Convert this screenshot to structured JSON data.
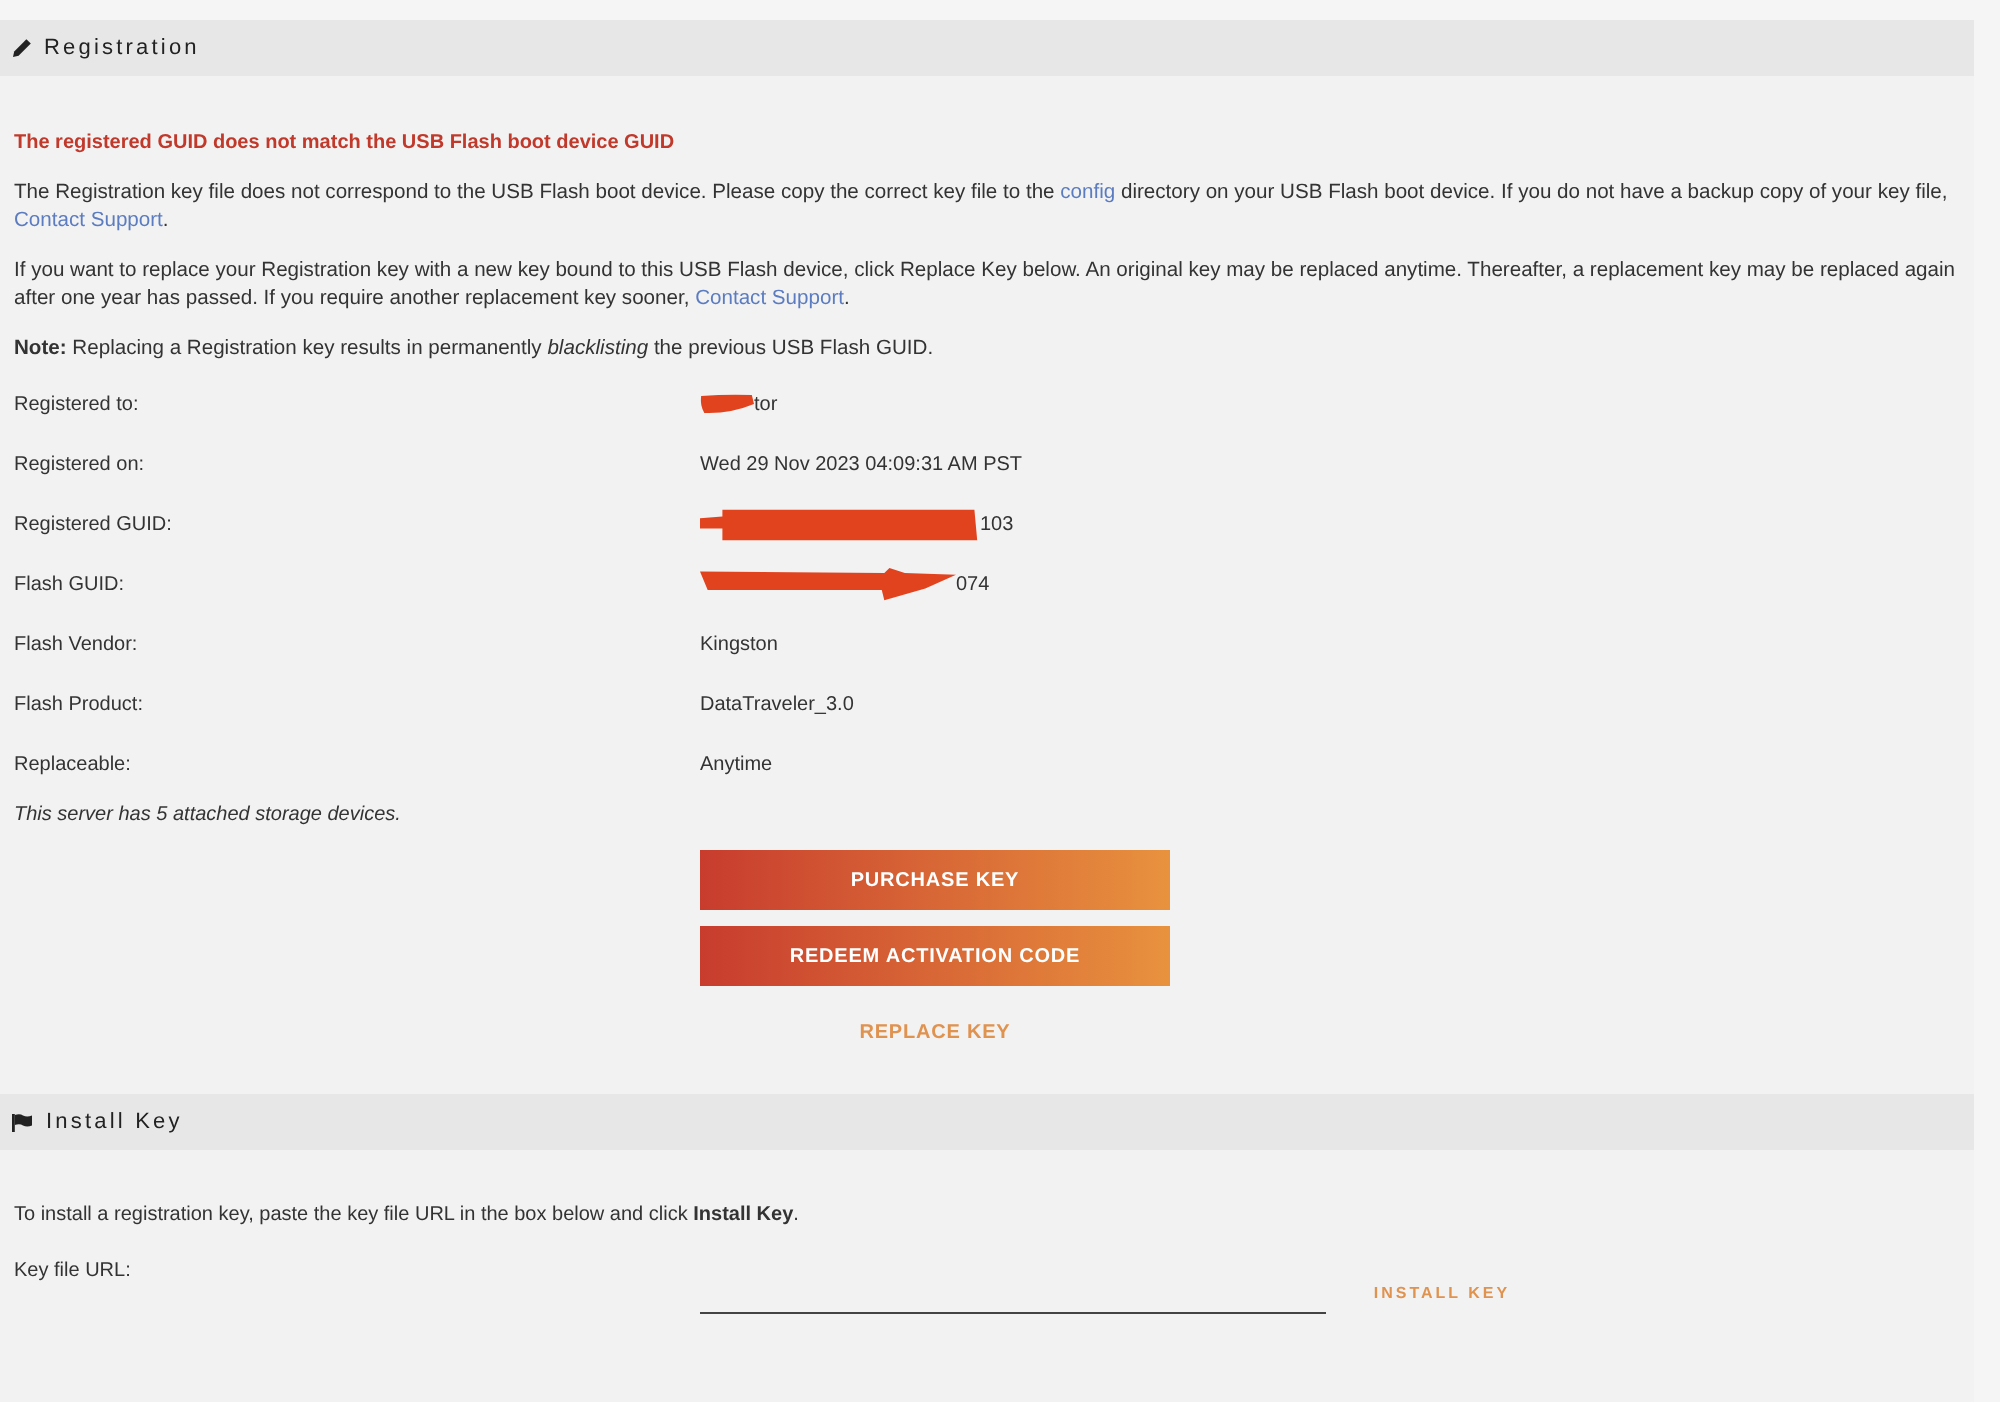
{
  "registration": {
    "title": "Registration",
    "error": "The registered GUID does not match the USB Flash boot device GUID",
    "paragraphs": [
      [
        {
          "kind": "text",
          "text": "The Registration key file does not correspond to the USB Flash boot device. Please copy the correct key file to the "
        },
        {
          "kind": "link",
          "text": "config"
        },
        {
          "kind": "text",
          "text": " directory on your USB Flash boot device. If you do not have a backup copy of your key file, "
        },
        {
          "kind": "link",
          "text": "Contact Support"
        },
        {
          "kind": "text",
          "text": "."
        }
      ],
      [
        {
          "kind": "text",
          "text": "If you want to replace your Registration key with a new key bound to this USB Flash device, click Replace Key below. An original key may be replaced anytime. Thereafter, a replacement key may be replaced again after one year has passed. If you require another replacement key sooner, "
        },
        {
          "kind": "link",
          "text": "Contact Support"
        },
        {
          "kind": "text",
          "text": "."
        }
      ]
    ],
    "note": "**Note:** Replacing a Registration key results in permanently *blacklisting* the previous USB Flash GUID.",
    "details": [
      {
        "label": "Registered to:",
        "value": "tor",
        "redacted": true
      },
      {
        "label": "Registered on:",
        "value": "Wed 29 Nov 2023 04:09:31 AM PST",
        "redacted": false
      },
      {
        "label": "Registered GUID:",
        "value": "103",
        "redacted": true
      },
      {
        "label": "Flash GUID:",
        "value": "074",
        "redacted": true
      },
      {
        "label": "Flash Vendor:",
        "value": "Kingston",
        "redacted": false
      },
      {
        "label": "Flash Product:",
        "value": "DataTraveler_3.0",
        "redacted": false
      },
      {
        "label": "Replaceable:",
        "value": "Anytime",
        "redacted": false
      }
    ],
    "footnote": "This server has 5 attached storage devices.",
    "buttons": [
      {
        "label": "PURCHASE KEY",
        "kind": "filled"
      },
      {
        "label": "REDEEM ACTIVATION CODE",
        "kind": "filled"
      },
      {
        "label": "REPLACE KEY",
        "kind": "outline"
      }
    ]
  },
  "install_key": {
    "title": "Install Key",
    "instructions": "To install a registration key, paste the key file URL in the box below and click **Install Key**.",
    "field_label": "Key file URL:",
    "button": "INSTALL KEY"
  }
}
